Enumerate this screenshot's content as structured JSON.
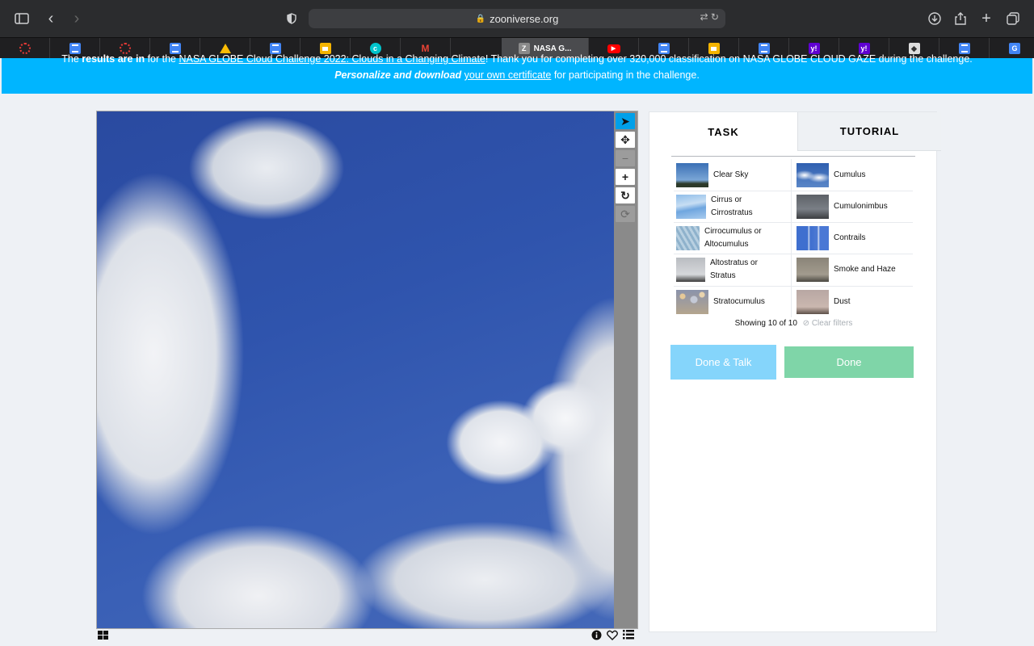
{
  "browser": {
    "url": "zooniverse.org",
    "active_tab_title": "NASA G...",
    "active_tab_icon": "Z",
    "tabs": [
      "ring",
      "doc",
      "ring",
      "doc",
      "drive",
      "doc",
      "slides",
      "canva",
      "gmail",
      "active",
      "youtube",
      "doc",
      "slides",
      "doc",
      "yahoo",
      "yahoo",
      "msu",
      "doc",
      "translate"
    ]
  },
  "banner": {
    "line1_a": "The ",
    "line1_b": "results are in",
    "line1_c": " for the ",
    "line1_link": "NASA GLOBE Cloud Challenge 2022: Clouds in a Changing Climate",
    "line1_d": "! Thank you for completing over 320,000 classification on NASA GLOBE CLOUD GAZE during the challenge.",
    "line2_b": "Personalize and download",
    "line2_link": "your own certificate",
    "line2_c": " for participating in the challenge."
  },
  "panel": {
    "tabs": {
      "task": "TASK",
      "tutorial": "TUTORIAL"
    },
    "choices": [
      {
        "label": "Clear Sky",
        "thumb": "clear"
      },
      {
        "label": "Cumulus",
        "thumb": "cumulus"
      },
      {
        "label": "Cirrus or Cirrostratus",
        "thumb": "cirrus"
      },
      {
        "label": "Cumulonimbus",
        "thumb": "cumulonimbus"
      },
      {
        "label": "Cirrocumulus or Altocumulus",
        "thumb": "cirrocumulus"
      },
      {
        "label": "Contrails",
        "thumb": "contrails"
      },
      {
        "label": "Altostratus or Stratus",
        "thumb": "alto"
      },
      {
        "label": "Smoke and Haze",
        "thumb": "smoke"
      },
      {
        "label": "Stratocumulus",
        "thumb": "strato"
      },
      {
        "label": "Dust",
        "thumb": "dust"
      }
    ],
    "showing": "Showing 10 of 10",
    "clear_filters": "Clear filters",
    "done_talk": "Done & Talk",
    "done": "Done"
  },
  "colors": {
    "banner": "#00b5ff",
    "done_talk": "#85d5fb",
    "done": "#7fd5a8",
    "active_tool": "#00a0e9"
  }
}
